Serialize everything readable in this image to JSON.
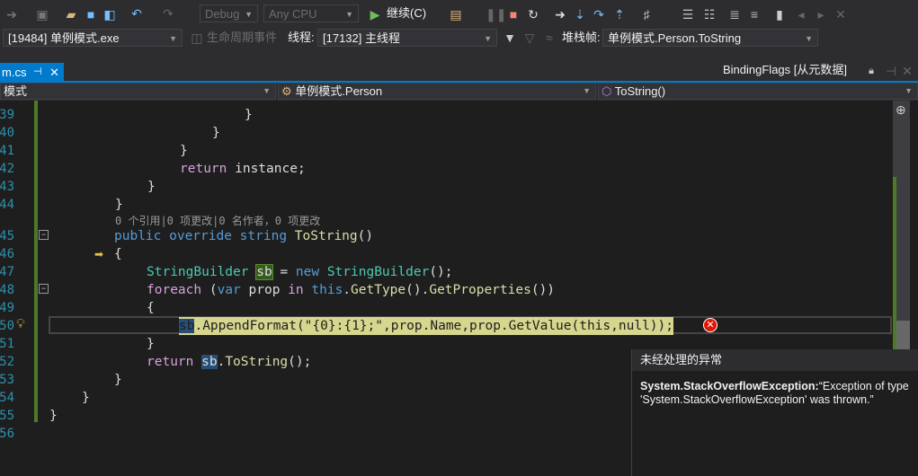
{
  "toolbar": {
    "config": "Debug",
    "platform": "Any CPU",
    "continue": "继续(C)"
  },
  "debugbar": {
    "process": "[19484] 单例模式.exe",
    "lifecycle": "生命周期事件",
    "thread_label": "线程:",
    "thread": "[17132] 主线程",
    "stack_label": "堆栈帧:",
    "stack": "单例模式.Person.ToString"
  },
  "tabs": {
    "active": "m.cs",
    "preview": "BindingFlags [从元数据]"
  },
  "nav": {
    "project": "模式",
    "class": "单例模式.Person",
    "member": "ToString()"
  },
  "codelens": "0 个引用|0 项更改|0 名作者，0 项更改",
  "lines": [
    "39",
    "40",
    "41",
    "42",
    "43",
    "44",
    "45",
    "46",
    "47",
    "48",
    "49",
    "50",
    "51",
    "52",
    "53",
    "54",
    "55",
    "56"
  ],
  "code": {
    "l42a": "return",
    "l42b": " instance;",
    "l45a": "public override string ",
    "l45b": "ToString",
    "l45c": "()",
    "l47a": "StringBuilder ",
    "l47b": "sb",
    "l47c": " = ",
    "l47d": "new ",
    "l47e": "StringBuilder",
    "l47f": "();",
    "l48a": "foreach",
    "l48b": " (",
    "l48c": "var",
    "l48d": " prop ",
    "l48e": "in",
    "l48f": " ",
    "l48g": "this",
    "l48h": ".",
    "l48i": "GetType",
    "l48j": "().",
    "l48k": "GetProperties",
    "l48l": "())",
    "l50a": "sb",
    "l50b": ".AppendFormat(\"{0}:{1};\",prop.Name,prop.GetValue(this,null));",
    "l52a": "return",
    "l52b": "sb",
    "l52c": ".",
    "l52d": "ToString",
    "l52e": "();"
  },
  "exception": {
    "title": "未经处理的异常",
    "type": "System.StackOverflowException:",
    "message": "“Exception of type 'System.StackOverflowException' was thrown.”"
  },
  "colors": {
    "accent": "#007acc",
    "keyword": "#569cd6",
    "type": "#4ec9b0",
    "error": "#e51400"
  }
}
